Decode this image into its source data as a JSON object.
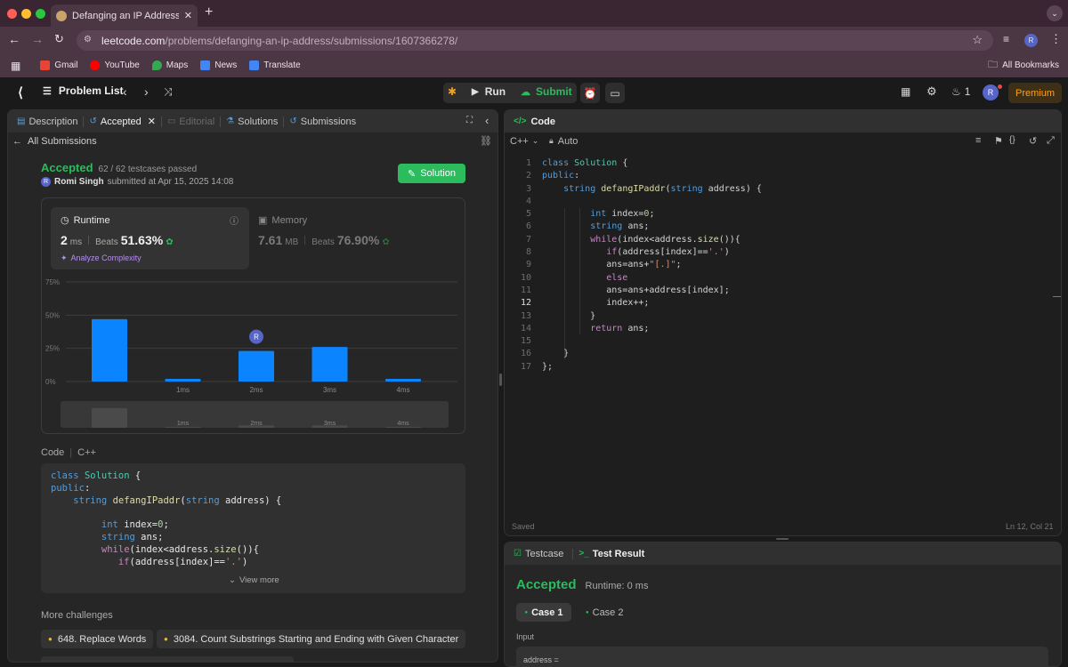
{
  "browser": {
    "tab_title": "Defanging an IP Address - Le",
    "url_host": "leetcode.com",
    "url_path": "/problems/defanging-an-ip-address/submissions/1607366278/",
    "profile_initial": "R",
    "bookmarks": [
      {
        "label": "Gmail",
        "color": "#ea4335"
      },
      {
        "label": "YouTube",
        "color": "#ff0000"
      },
      {
        "label": "Maps",
        "color": "#34a853"
      },
      {
        "label": "News",
        "color": "#4285f4"
      },
      {
        "label": "Translate",
        "color": "#4285f4"
      }
    ],
    "all_bookmarks": "All Bookmarks"
  },
  "nav": {
    "problem_list": "Problem List",
    "run": "Run",
    "submit": "Submit",
    "streak": "1",
    "avatar": "R",
    "premium": "Premium"
  },
  "left": {
    "tabs": {
      "description": "Description",
      "accepted": "Accepted",
      "editorial": "Editorial",
      "solutions": "Solutions",
      "submissions": "Submissions"
    },
    "back": "All Submissions",
    "status": "Accepted",
    "testcases": "62 / 62 testcases passed",
    "user": "Romi Singh",
    "submitted": "submitted at Apr 15, 2025 14:08",
    "solution_btn": "Solution",
    "runtime": {
      "label": "Runtime",
      "value": "2",
      "unit": "ms",
      "beats_label": "Beats",
      "beats": "51.63%",
      "analyze": "Analyze Complexity"
    },
    "memory": {
      "label": "Memory",
      "value": "7.61",
      "unit": "MB",
      "beats_label": "Beats",
      "beats": "76.90%"
    },
    "code_label": "Code",
    "lang": "C++",
    "view_more": "View more",
    "more_challenges": "More challenges",
    "challenges": [
      "648. Replace Words",
      "3084. Count Substrings Starting and Ending with Given Character"
    ]
  },
  "chart_data": {
    "type": "bar",
    "categories": [
      "",
      "1ms",
      "2ms",
      "3ms",
      "4ms"
    ],
    "values": [
      47,
      2,
      23,
      26,
      2
    ],
    "highlight_index": 2,
    "highlight_label": "R",
    "yticks": [
      "75%",
      "50%",
      "25%",
      "0%"
    ],
    "ylim": [
      0,
      75
    ],
    "bar_color": "#0a84ff",
    "mini_values": [
      100,
      5,
      12,
      12,
      5
    ]
  },
  "editor": {
    "title": "Code",
    "lang": "C++",
    "mode": "Auto",
    "saved": "Saved",
    "cursor": "Ln 12, Col 21",
    "active_line": 12
  },
  "result": {
    "tab_testcase": "Testcase",
    "tab_result": "Test Result",
    "status": "Accepted",
    "runtime": "Runtime: 0 ms",
    "case1": "Case 1",
    "case2": "Case 2",
    "input_label": "Input",
    "input_value": "address ="
  }
}
